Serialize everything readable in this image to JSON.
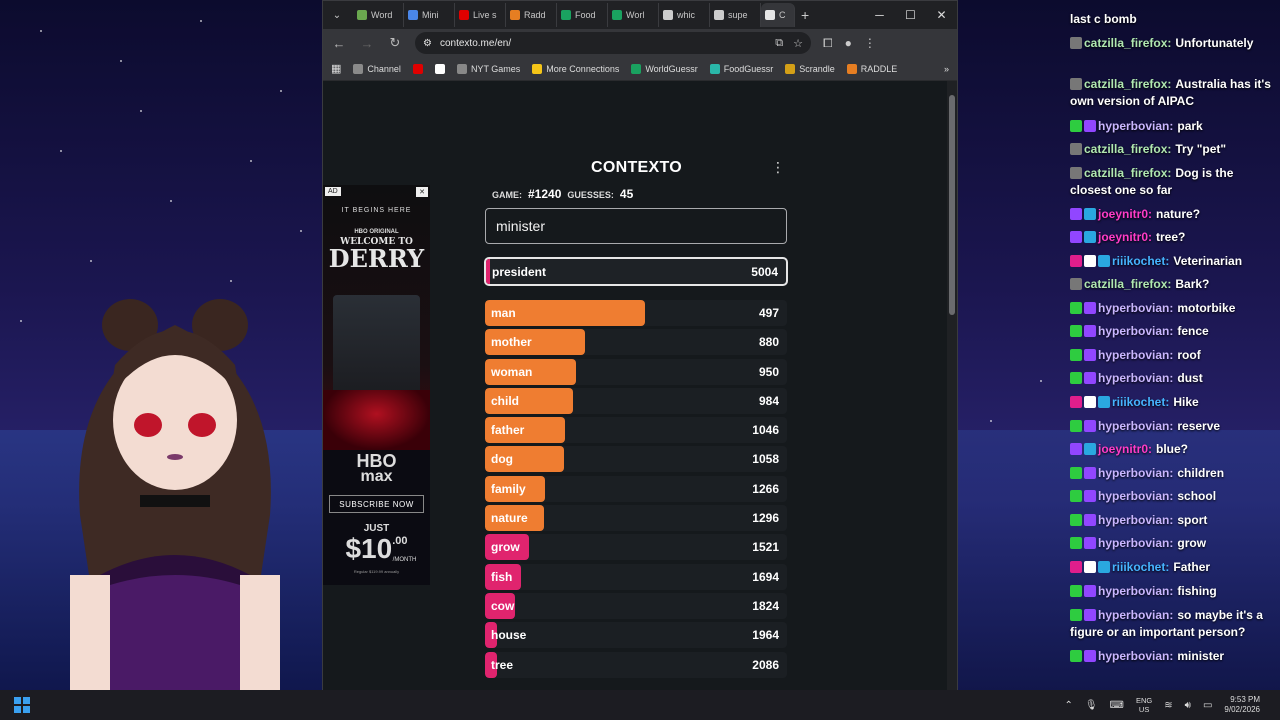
{
  "browser": {
    "tabs": [
      {
        "label": "Word",
        "color": "#6aa84f"
      },
      {
        "label": "Mini",
        "color": "#4a86e8"
      },
      {
        "label": "Live s",
        "color": "#e00000"
      },
      {
        "label": "Radd",
        "color": "#e67e22"
      },
      {
        "label": "Food",
        "color": "#1aa260"
      },
      {
        "label": "Worl",
        "color": "#1aa260"
      },
      {
        "label": "whic",
        "color": "#cccccc"
      },
      {
        "label": "supe",
        "color": "#cccccc"
      },
      {
        "label": "C",
        "color": "#e6e6e6"
      }
    ],
    "url": "contexto.me/en/",
    "bookmarks": [
      {
        "label": "Channel",
        "color": "#8a8a8a"
      },
      {
        "label": "",
        "color": "#e00000"
      },
      {
        "label": "",
        "color": "#ffffff"
      },
      {
        "label": "NYT Games",
        "color": "#888888"
      },
      {
        "label": "More Connections",
        "color": "#f5c518"
      },
      {
        "label": "WorldGuessr",
        "color": "#1aa260"
      },
      {
        "label": "FoodGuessr",
        "color": "#2ab7a9"
      },
      {
        "label": "Scrandle",
        "color": "#d4a017"
      },
      {
        "label": "RADDLE",
        "color": "#e67e22"
      }
    ],
    "bookmarks_more": "»"
  },
  "ad": {
    "tag": "AD",
    "tagline": "IT BEGINS HERE",
    "hbo_original": "HBO ORIGINAL",
    "title_line1": "WELCOME TO",
    "title_line2": "DERRY",
    "brand_line1": "HBO",
    "brand_line2": "max",
    "cta": "SUBSCRIBE NOW",
    "price_prefix": "JUST",
    "price_main": "$10",
    "price_cents": ".00",
    "price_period": "/MONTH",
    "fineprint": "Regular $119.99 annually"
  },
  "contexto": {
    "title": "CONTEXTO",
    "game_label": "GAME:",
    "game_number": "#1240",
    "guesses_label": "GUESSES:",
    "guesses_count": "45",
    "input_value": "minister",
    "last_guess": {
      "word": "president",
      "rank": "5004"
    },
    "guesses": [
      {
        "word": "man",
        "rank": "497",
        "fill": 0.53,
        "color": "#ef7d31"
      },
      {
        "word": "mother",
        "rank": "880",
        "fill": 0.33,
        "color": "#ef7d31"
      },
      {
        "word": "woman",
        "rank": "950",
        "fill": 0.3,
        "color": "#ef7d31"
      },
      {
        "word": "child",
        "rank": "984",
        "fill": 0.29,
        "color": "#ef7d31"
      },
      {
        "word": "father",
        "rank": "1046",
        "fill": 0.265,
        "color": "#ef7d31"
      },
      {
        "word": "dog",
        "rank": "1058",
        "fill": 0.263,
        "color": "#ef7d31"
      },
      {
        "word": "family",
        "rank": "1266",
        "fill": 0.2,
        "color": "#ef7d31"
      },
      {
        "word": "nature",
        "rank": "1296",
        "fill": 0.195,
        "color": "#ef7d31"
      },
      {
        "word": "grow",
        "rank": "1521",
        "fill": 0.145,
        "color": "#e0246e"
      },
      {
        "word": "fish",
        "rank": "1694",
        "fill": 0.12,
        "color": "#e0246e"
      },
      {
        "word": "cow",
        "rank": "1824",
        "fill": 0.1,
        "color": "#e0246e"
      },
      {
        "word": "house",
        "rank": "1964",
        "fill": 0.04,
        "color": "#e0246e"
      },
      {
        "word": "tree",
        "rank": "2086",
        "fill": 0.04,
        "color": "#e0246e"
      }
    ]
  },
  "chat": {
    "messages": [
      {
        "user": "",
        "text": "last c bomb",
        "color": "#ffffff",
        "badges": []
      },
      {
        "user": "catzilla_firefox:",
        "text": "Unfortunately",
        "color": "#b0e8b0",
        "badges": [
          "#777777"
        ]
      },
      {
        "user": "catzilla_firefox:",
        "text": "Australia has it's own version of AIPAC",
        "color": "#b0e8b0",
        "badges": [
          "#777777"
        ]
      },
      {
        "user": "hyperbovian:",
        "text": "park",
        "color": "#c9b6ff",
        "badges": [
          "#2ecc40",
          "#9146ff"
        ]
      },
      {
        "user": "catzilla_firefox:",
        "text": "Try \"pet\"",
        "color": "#b0e8b0",
        "badges": [
          "#777777"
        ]
      },
      {
        "user": "catzilla_firefox:",
        "text": "Dog is the closest one so far",
        "color": "#b0e8b0",
        "badges": [
          "#777777"
        ]
      },
      {
        "user": "joeynitr0:",
        "text": "nature?",
        "color": "#ff3cc8",
        "badges": [
          "#9146ff",
          "#2aa8e0"
        ]
      },
      {
        "user": "joeynitr0:",
        "text": "tree?",
        "color": "#ff3cc8",
        "badges": [
          "#9146ff",
          "#2aa8e0"
        ]
      },
      {
        "user": "riiikochet:",
        "text": "Veterinarian",
        "color": "#46b4ff",
        "badges": [
          "#e01e8c",
          "#ffffff",
          "#2aa8e0"
        ]
      },
      {
        "user": "catzilla_firefox:",
        "text": "Bark?",
        "color": "#b0e8b0",
        "badges": [
          "#777777"
        ]
      },
      {
        "user": "hyperbovian:",
        "text": "motorbike",
        "color": "#c9b6ff",
        "badges": [
          "#2ecc40",
          "#9146ff"
        ]
      },
      {
        "user": "hyperbovian:",
        "text": "fence",
        "color": "#c9b6ff",
        "badges": [
          "#2ecc40",
          "#9146ff"
        ]
      },
      {
        "user": "hyperbovian:",
        "text": "roof",
        "color": "#c9b6ff",
        "badges": [
          "#2ecc40",
          "#9146ff"
        ]
      },
      {
        "user": "hyperbovian:",
        "text": "dust",
        "color": "#c9b6ff",
        "badges": [
          "#2ecc40",
          "#9146ff"
        ]
      },
      {
        "user": "riiikochet:",
        "text": "Hike",
        "color": "#46b4ff",
        "badges": [
          "#e01e8c",
          "#ffffff",
          "#2aa8e0"
        ]
      },
      {
        "user": "hyperbovian:",
        "text": "reserve",
        "color": "#c9b6ff",
        "badges": [
          "#2ecc40",
          "#9146ff"
        ]
      },
      {
        "user": "joeynitr0:",
        "text": "blue?",
        "color": "#ff3cc8",
        "badges": [
          "#9146ff",
          "#2aa8e0"
        ]
      },
      {
        "user": "hyperbovian:",
        "text": "children",
        "color": "#c9b6ff",
        "badges": [
          "#2ecc40",
          "#9146ff"
        ]
      },
      {
        "user": "hyperbovian:",
        "text": "school",
        "color": "#c9b6ff",
        "badges": [
          "#2ecc40",
          "#9146ff"
        ]
      },
      {
        "user": "hyperbovian:",
        "text": "sport",
        "color": "#c9b6ff",
        "badges": [
          "#2ecc40",
          "#9146ff"
        ]
      },
      {
        "user": "hyperbovian:",
        "text": "grow",
        "color": "#c9b6ff",
        "badges": [
          "#2ecc40",
          "#9146ff"
        ]
      },
      {
        "user": "riiikochet:",
        "text": "Father",
        "color": "#46b4ff",
        "badges": [
          "#e01e8c",
          "#ffffff",
          "#2aa8e0"
        ]
      },
      {
        "user": "hyperbovian:",
        "text": "fishing",
        "color": "#c9b6ff",
        "badges": [
          "#2ecc40",
          "#9146ff"
        ]
      },
      {
        "user": "hyperbovian:",
        "text": "so maybe it's a figure or an important person?",
        "color": "#c9b6ff",
        "badges": [
          "#2ecc40",
          "#9146ff"
        ]
      },
      {
        "user": "hyperbovian:",
        "text": "minister",
        "color": "#c9b6ff",
        "badges": [
          "#2ecc40",
          "#9146ff"
        ]
      }
    ]
  },
  "taskbar": {
    "lang_line1": "ENG",
    "lang_line2": "US",
    "time": "9:53 PM",
    "date": "9/02/2026"
  }
}
